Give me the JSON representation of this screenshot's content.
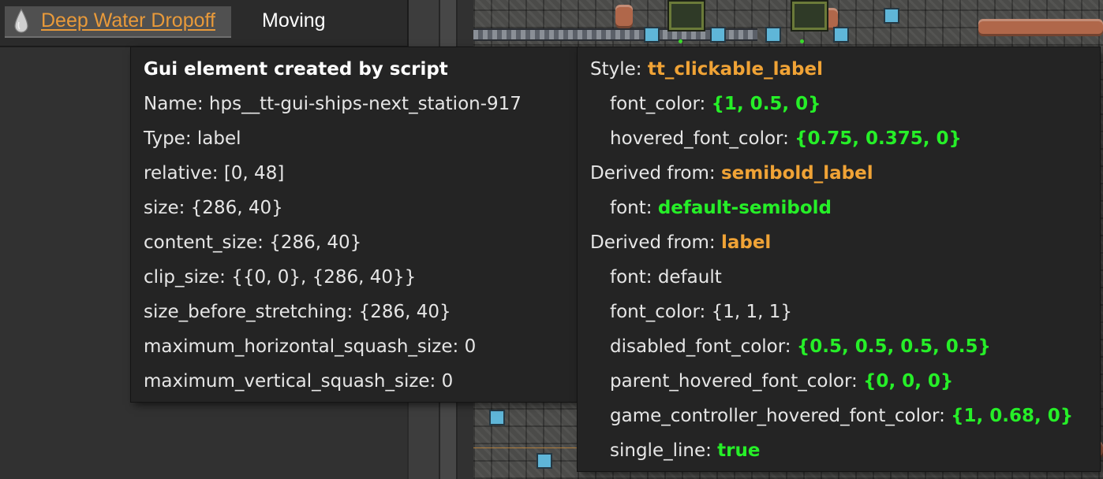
{
  "topbar": {
    "station_name": "Deep Water Dropoff",
    "status": "Moving",
    "icon": "water-drop-icon"
  },
  "left_tooltip": {
    "title": "Gui element created by script",
    "rows": [
      {
        "key": "Name:",
        "value": "hps__tt-gui-ships-next_station-917"
      },
      {
        "key": "Type:",
        "value": "label"
      },
      {
        "key": "relative:",
        "value": "[0, 48]"
      },
      {
        "key": "size:",
        "value": "{286, 40}"
      },
      {
        "key": "content_size:",
        "value": "{286, 40}"
      },
      {
        "key": "clip_size:",
        "value": "{{0, 0}, {286, 40}}"
      },
      {
        "key": "size_before_stretching:",
        "value": "{286, 40}"
      },
      {
        "key": "maximum_horizontal_squash_size:",
        "value": "0"
      },
      {
        "key": "maximum_vertical_squash_size:",
        "value": "0"
      }
    ]
  },
  "right_tooltip": {
    "style_key": "Style:",
    "style_value": "tt_clickable_label",
    "style_props": [
      {
        "key": "font_color:",
        "value": "{1, 0.5, 0}"
      },
      {
        "key": "hovered_font_color:",
        "value": "{0.75, 0.375, 0}"
      }
    ],
    "derived1_key": "Derived from:",
    "derived1_value": "semibold_label",
    "derived1_props": [
      {
        "key": "font:",
        "value": "default-semibold"
      }
    ],
    "derived2_key": "Derived from:",
    "derived2_value": "label",
    "derived2_props": [
      {
        "key": "font:",
        "value": "default"
      },
      {
        "key": "font_color:",
        "value": "{1, 1, 1}"
      },
      {
        "key": "disabled_font_color:",
        "value": "{0.5, 0.5, 0.5, 0.5}"
      },
      {
        "key": "parent_hovered_font_color:",
        "value": "{0, 0, 0}"
      },
      {
        "key": "game_controller_hovered_font_color:",
        "value": "{1, 0.68, 0}"
      },
      {
        "key": "single_line:",
        "value": "true"
      }
    ]
  },
  "colors": {
    "link_orange": "#e99a3a",
    "style_orange": "#f0a336",
    "value_green": "#26ef28",
    "tooltip_bg": "#242424"
  }
}
